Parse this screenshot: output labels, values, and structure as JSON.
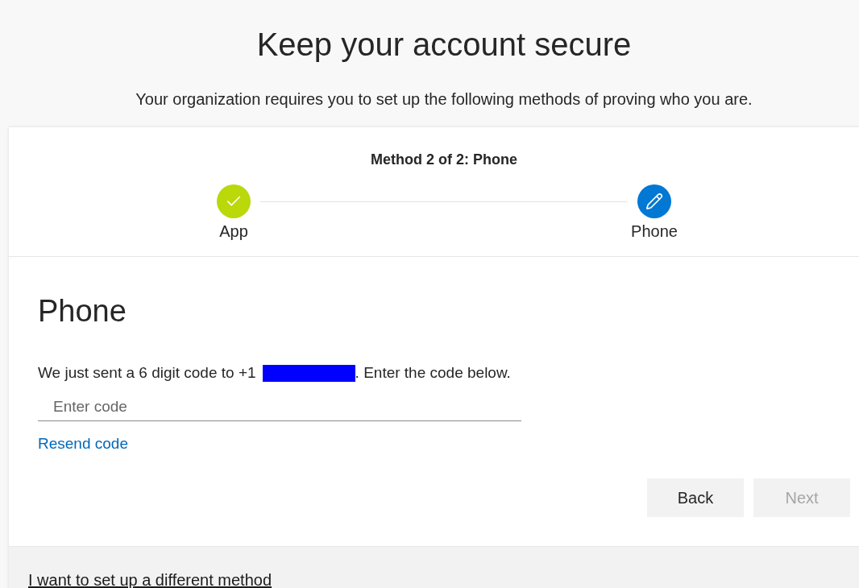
{
  "title": "Keep your account secure",
  "subtitle": "Your organization requires you to set up the following methods of proving who you are.",
  "progress": {
    "label": "Method 2 of 2: Phone",
    "steps": [
      {
        "label": "App",
        "completed": true
      },
      {
        "label": "Phone",
        "completed": false
      }
    ]
  },
  "method": {
    "heading": "Phone",
    "message_start": "We just sent a 6 digit code to +1",
    "phone_redacted": true,
    "message_end": ". Enter the code below.",
    "code_field": {
      "placeholder": "Enter code"
    },
    "resend_link": "Resend code"
  },
  "buttons": [
    {
      "label": "Back",
      "disabled": false
    },
    {
      "label": "Next",
      "disabled": true
    }
  ],
  "footer": {
    "link": "I want to set up a different method"
  }
}
